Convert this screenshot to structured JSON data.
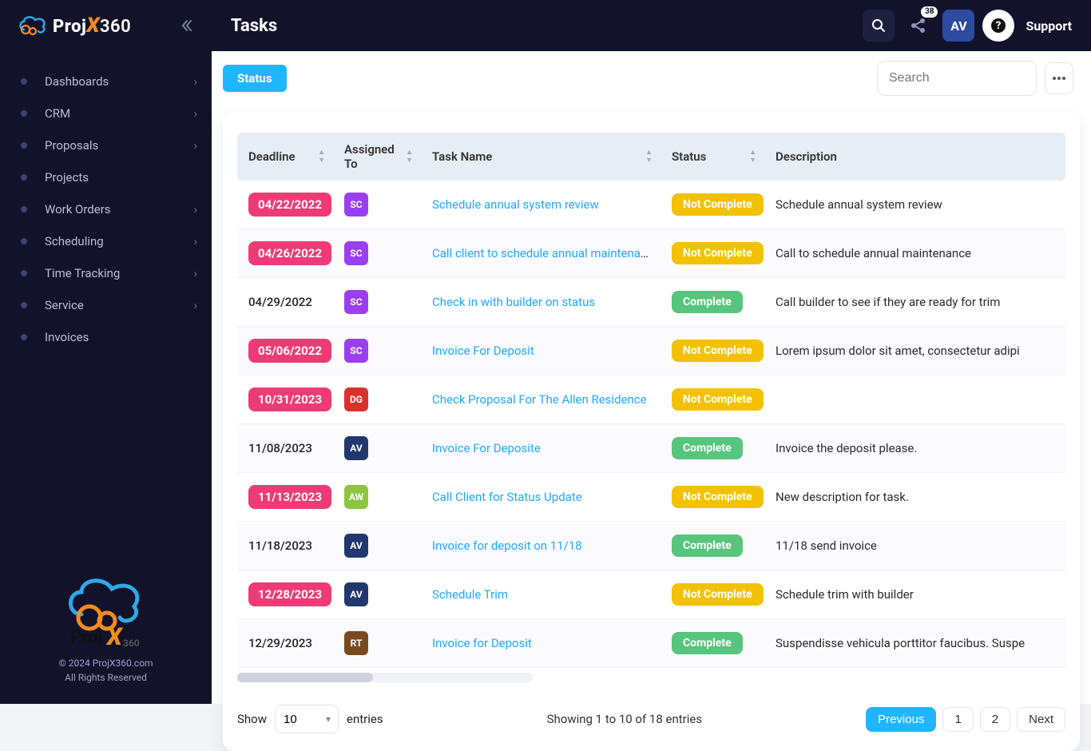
{
  "brand": {
    "name": "ProjX360"
  },
  "header": {
    "title": "Tasks",
    "user_initials": "AV",
    "support_label": "Support",
    "notification_count": "38"
  },
  "sidebar": {
    "items": [
      {
        "label": "Dashboards",
        "has_children": true
      },
      {
        "label": "CRM",
        "has_children": true
      },
      {
        "label": "Proposals",
        "has_children": true
      },
      {
        "label": "Projects",
        "has_children": false
      },
      {
        "label": "Work Orders",
        "has_children": true
      },
      {
        "label": "Scheduling",
        "has_children": true
      },
      {
        "label": "Time Tracking",
        "has_children": true
      },
      {
        "label": "Service",
        "has_children": true
      },
      {
        "label": "Invoices",
        "has_children": false
      }
    ],
    "footer1": "© 2024 ProjX360.com",
    "footer2": "All Rights Reserved"
  },
  "toolbar": {
    "status_label": "Status",
    "search_placeholder": "Search"
  },
  "table": {
    "columns": [
      "Deadline",
      "Assigned To",
      "Task Name",
      "Status",
      "Description"
    ],
    "rows": [
      {
        "deadline": "04/22/2022",
        "overdue": true,
        "assignee": "SC",
        "avclass": "av-purple",
        "task": "Schedule annual system review",
        "status": "Not Complete",
        "desc": "Schedule annual system review"
      },
      {
        "deadline": "04/26/2022",
        "overdue": true,
        "assignee": "SC",
        "avclass": "av-purple",
        "task": "Call client to schedule annual maintenance",
        "status": "Not Complete",
        "desc": "Call to schedule annual maintenance"
      },
      {
        "deadline": "04/29/2022",
        "overdue": false,
        "assignee": "SC",
        "avclass": "av-purple",
        "task": "Check in with builder on status",
        "status": "Complete",
        "desc": "Call builder to see if they are ready for trim"
      },
      {
        "deadline": "05/06/2022",
        "overdue": true,
        "assignee": "SC",
        "avclass": "av-purple",
        "task": "Invoice For Deposit",
        "status": "Not Complete",
        "desc": "Lorem ipsum dolor sit amet, consectetur adipi"
      },
      {
        "deadline": "10/31/2023",
        "overdue": true,
        "assignee": "DG",
        "avclass": "av-red",
        "task": "Check Proposal For The Allen Residence",
        "status": "Not Complete",
        "desc": ""
      },
      {
        "deadline": "11/08/2023",
        "overdue": false,
        "assignee": "AV",
        "avclass": "av-navy",
        "task": "Invoice For Deposite",
        "status": "Complete",
        "desc": "Invoice the deposit please."
      },
      {
        "deadline": "11/13/2023",
        "overdue": true,
        "assignee": "AW",
        "avclass": "av-green",
        "task": "Call Client for Status Update",
        "status": "Not Complete",
        "desc": "New description for task."
      },
      {
        "deadline": "11/18/2023",
        "overdue": false,
        "assignee": "AV",
        "avclass": "av-navy",
        "task": "Invoice for deposit on 11/18",
        "status": "Complete",
        "desc": "11/18 send invoice"
      },
      {
        "deadline": "12/28/2023",
        "overdue": true,
        "assignee": "AV",
        "avclass": "av-navy",
        "task": "Schedule Trim",
        "status": "Not Complete",
        "desc": "Schedule trim with builder"
      },
      {
        "deadline": "12/29/2023",
        "overdue": false,
        "assignee": "RT",
        "avclass": "av-brown",
        "task": "Invoice for Deposit",
        "status": "Complete",
        "desc": "Suspendisse vehicula porttitor faucibus. Suspe"
      }
    ]
  },
  "footer": {
    "show_label": "Show",
    "entries_label": "entries",
    "entries_value": "10",
    "showing_info": "Showing 1 to 10 of 18 entries",
    "prev_label": "Previous",
    "next_label": "Next",
    "pages": [
      "1",
      "2"
    ],
    "active_page": "1"
  }
}
